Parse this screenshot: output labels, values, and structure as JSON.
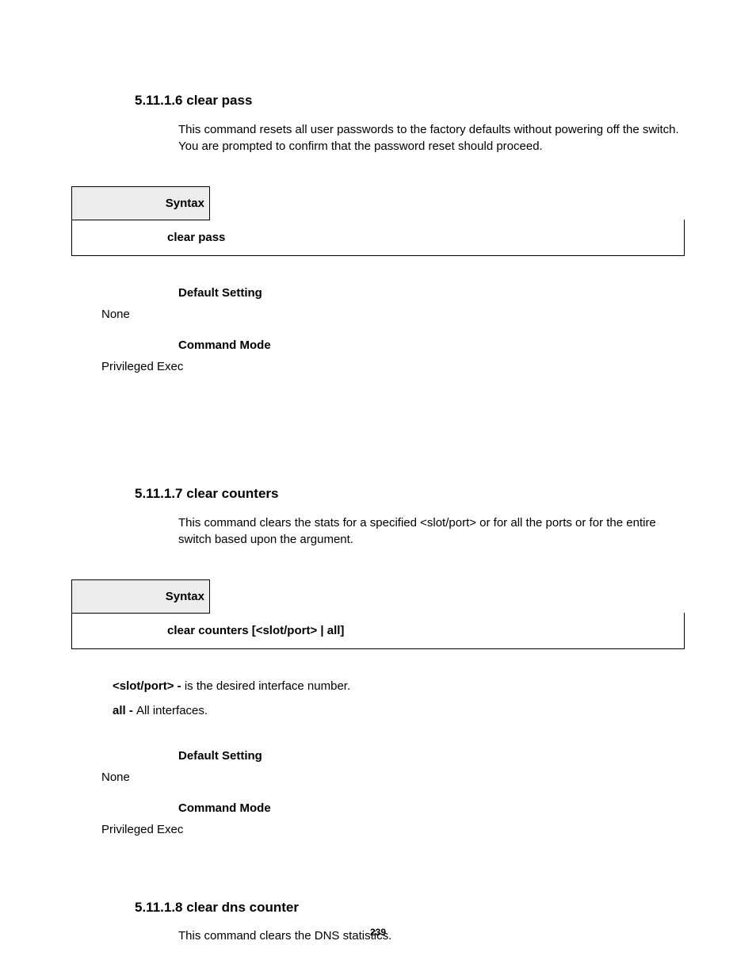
{
  "page_number": "239",
  "sections": [
    {
      "num": "5.11.1.6",
      "title": "clear pass",
      "desc": "This command resets all user passwords to the factory defaults without powering off the switch. You are prompted to confirm that the password reset should proceed.",
      "syntax_label": "Syntax",
      "syntax_cmd": "clear pass",
      "default_label": "Default Setting",
      "default_value": "None",
      "mode_label": "Command Mode",
      "mode_value": "Privileged Exec"
    },
    {
      "num": "5.11.1.7",
      "title": "clear counters",
      "desc": "This command clears the stats for a specified <slot/port> or for all the ports or for the entire switch based upon the argument.",
      "syntax_label": "Syntax",
      "syntax_cmd": "clear counters [<slot/port> | all]",
      "param1_bold": "<slot/port> - ",
      "param1_rest": "is the desired interface number.",
      "param2_bold": "all - ",
      "param2_rest": "All interfaces.",
      "default_label": "Default Setting",
      "default_value": "None",
      "mode_label": "Command Mode",
      "mode_value": "Privileged Exec"
    },
    {
      "num": "5.11.1.8",
      "title": "clear dns counter",
      "desc": "This command clears the DNS statistics."
    }
  ]
}
